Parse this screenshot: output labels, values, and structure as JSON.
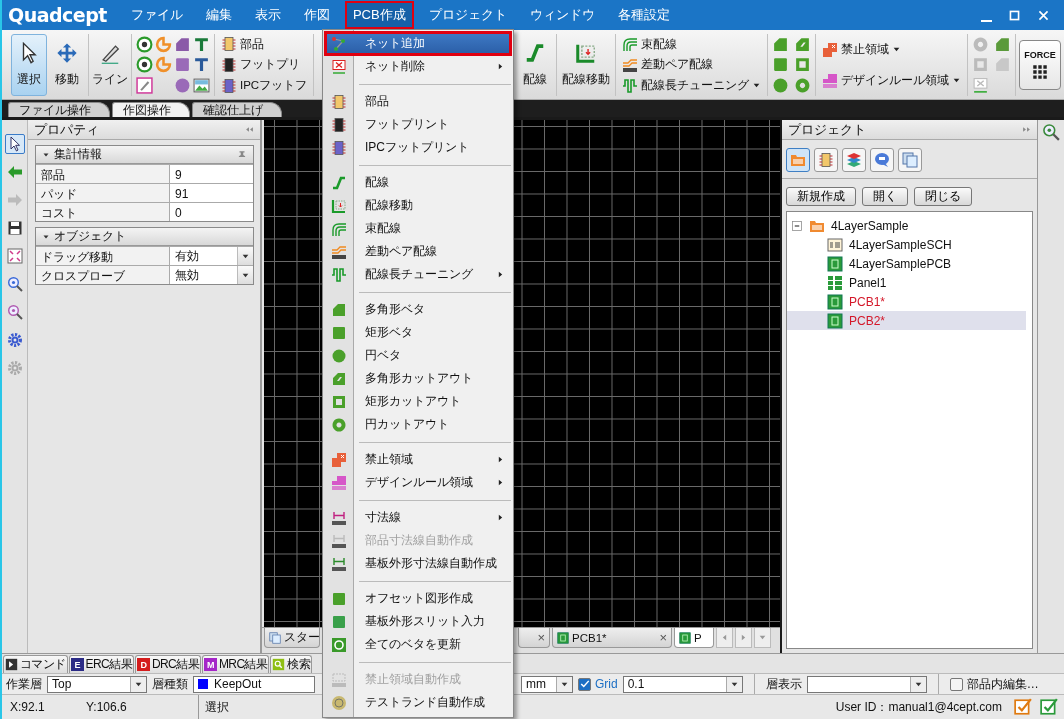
{
  "app": {
    "logo": "Quadcept"
  },
  "menubar": [
    {
      "label": "ファイル",
      "selected": false
    },
    {
      "label": "編集",
      "selected": false
    },
    {
      "label": "表示",
      "selected": false
    },
    {
      "label": "作図",
      "selected": false
    },
    {
      "label": "PCB作成",
      "selected": true
    },
    {
      "label": "プロジェクト",
      "selected": false
    },
    {
      "label": "ウィンドウ",
      "selected": false
    },
    {
      "label": "各種設定",
      "selected": false
    }
  ],
  "ribbon": {
    "groups": [
      {
        "kind": "large",
        "buttons": [
          {
            "label": "選択",
            "selected": true
          },
          {
            "label": "移動",
            "selected": false
          }
        ]
      },
      {
        "kind": "large",
        "buttons": [
          {
            "label": "ライン",
            "selected": false
          }
        ]
      },
      {
        "kind": "icons"
      },
      {
        "kind": "small",
        "items": [
          {
            "label": "部品",
            "dropdown": false
          },
          {
            "label": "フットプリ",
            "dropdown": false
          },
          {
            "label": "IPCフットフ",
            "dropdown": false
          }
        ]
      },
      {
        "kind": "large",
        "buttons": [
          {
            "label": "配線",
            "selected": false
          }
        ]
      },
      {
        "kind": "large",
        "buttons": [
          {
            "label": "配線移動",
            "selected": false
          }
        ]
      },
      {
        "kind": "small",
        "items": [
          {
            "label": "束配線",
            "dropdown": false
          },
          {
            "label": "差動ペア配線",
            "dropdown": false
          },
          {
            "label": "配線長チューニング",
            "dropdown": true
          }
        ]
      },
      {
        "kind": "icons"
      },
      {
        "kind": "small",
        "items": [
          {
            "label": "禁止領域",
            "dropdown": true
          },
          {
            "label": "デザインルール領域",
            "dropdown": true
          }
        ]
      },
      {
        "kind": "icons"
      },
      {
        "kind": "force",
        "label": "FORCE"
      }
    ]
  },
  "ribbon_tabs": [
    {
      "label": "ファイル操作",
      "selected": false
    },
    {
      "label": "作図操作",
      "selected": true
    },
    {
      "label": "確認仕上げ",
      "selected": false
    }
  ],
  "properties": {
    "title": "プロパティ",
    "sections": [
      {
        "title": "集計情報",
        "expanded": true,
        "rows": [
          {
            "name": "部品",
            "value": "9"
          },
          {
            "name": "パッド",
            "value": "91"
          },
          {
            "name": "コスト",
            "value": "0"
          }
        ]
      },
      {
        "title": "オブジェクト",
        "expanded": true,
        "rows": [
          {
            "name": "ドラッグ移動",
            "value": "有効",
            "dropdown": true
          },
          {
            "name": "クロスプローブ",
            "value": "無効",
            "dropdown": true
          }
        ]
      }
    ]
  },
  "doc_tabs": [
    {
      "label": "スター",
      "selected": false
    },
    {
      "close": "×",
      "selected": false
    },
    {
      "label": "PCB1*",
      "close": "×",
      "selected": false
    },
    {
      "label": "P",
      "selected": true
    }
  ],
  "project": {
    "title": "プロジェクト",
    "view_buttons": [
      {
        "selected": true
      },
      {
        "selected": false
      },
      {
        "selected": false
      },
      {
        "selected": false
      },
      {
        "selected": false
      }
    ],
    "buttons": [
      "新規作成",
      "開く",
      "閉じる"
    ],
    "tree": [
      {
        "label": "4LayerSample",
        "kind": "project",
        "expanded": true,
        "selected": false,
        "modified": false,
        "children": [
          {
            "label": "4LayerSampleSCH",
            "kind": "sch",
            "selected": false,
            "modified": false
          },
          {
            "label": "4LayerSamplePCB",
            "kind": "pcb",
            "selected": false,
            "modified": false
          },
          {
            "label": "Panel1",
            "kind": "panel",
            "selected": false,
            "modified": false
          },
          {
            "label": "PCB1*",
            "kind": "pcb",
            "selected": false,
            "modified": true
          },
          {
            "label": "PCB2*",
            "kind": "pcb",
            "selected": true,
            "modified": true
          }
        ]
      }
    ]
  },
  "bottom_tabs": [
    {
      "label": "コマンド",
      "color": "#333333"
    },
    {
      "label": "ERC結果",
      "badge": "E",
      "color": "#2b2b86"
    },
    {
      "label": "DRC結果",
      "badge": "D",
      "color": "#d41c1c"
    },
    {
      "label": "MRC結果",
      "badge": "M",
      "color": "#a526c8"
    },
    {
      "label": "検索",
      "color": "#8fbf14"
    }
  ],
  "options_bar": {
    "work_layer_label": "作業層",
    "work_layer": "Top",
    "layer_type_label": "層種類",
    "layer_type": "KeepOut",
    "unit": "mm",
    "grid": {
      "label": "Grid",
      "checked": true
    },
    "grid_value": "0.1",
    "layer_display_label": "層表示",
    "part_edit": {
      "label": "部品内編集…",
      "checked": false
    }
  },
  "status_bar": {
    "x": "X:92.1",
    "y": "Y:106.6",
    "mode": "選択",
    "user": "User ID：manual1@4cept.com"
  },
  "pcb_menu": {
    "items": [
      {
        "kind": "item",
        "label": "ネット追加",
        "selected": true,
        "disabled": false,
        "submenu": false
      },
      {
        "kind": "item",
        "label": "ネット削除",
        "selected": false,
        "disabled": false,
        "submenu": true
      },
      {
        "kind": "separator"
      },
      {
        "kind": "item",
        "label": "部品",
        "selected": false,
        "disabled": false,
        "submenu": false
      },
      {
        "kind": "item",
        "label": "フットプリント",
        "selected": false,
        "disabled": false,
        "submenu": false
      },
      {
        "kind": "item",
        "label": "IPCフットプリント",
        "selected": false,
        "disabled": false,
        "submenu": false
      },
      {
        "kind": "separator"
      },
      {
        "kind": "item",
        "label": "配線",
        "selected": false,
        "disabled": false,
        "submenu": false
      },
      {
        "kind": "item",
        "label": "配線移動",
        "selected": false,
        "disabled": false,
        "submenu": false
      },
      {
        "kind": "item",
        "label": "束配線",
        "selected": false,
        "disabled": false,
        "submenu": false
      },
      {
        "kind": "item",
        "label": "差動ペア配線",
        "selected": false,
        "disabled": false,
        "submenu": false
      },
      {
        "kind": "item",
        "label": "配線長チューニング",
        "selected": false,
        "disabled": false,
        "submenu": true
      },
      {
        "kind": "separator"
      },
      {
        "kind": "item",
        "label": "多角形ベタ",
        "selected": false,
        "disabled": false,
        "submenu": false
      },
      {
        "kind": "item",
        "label": "矩形ベタ",
        "selected": false,
        "disabled": false,
        "submenu": false
      },
      {
        "kind": "item",
        "label": "円ベタ",
        "selected": false,
        "disabled": false,
        "submenu": false
      },
      {
        "kind": "item",
        "label": "多角形カットアウト",
        "selected": false,
        "disabled": false,
        "submenu": false
      },
      {
        "kind": "item",
        "label": "矩形カットアウト",
        "selected": false,
        "disabled": false,
        "submenu": false
      },
      {
        "kind": "item",
        "label": "円カットアウト",
        "selected": false,
        "disabled": false,
        "submenu": false
      },
      {
        "kind": "separator"
      },
      {
        "kind": "item",
        "label": "禁止領域",
        "selected": false,
        "disabled": false,
        "submenu": true
      },
      {
        "kind": "item",
        "label": "デザインルール領域",
        "selected": false,
        "disabled": false,
        "submenu": true
      },
      {
        "kind": "separator"
      },
      {
        "kind": "item",
        "label": "寸法線",
        "selected": false,
        "disabled": false,
        "submenu": true
      },
      {
        "kind": "item",
        "label": "部品寸法線自動作成",
        "selected": false,
        "disabled": true,
        "submenu": false
      },
      {
        "kind": "item",
        "label": "基板外形寸法線自動作成",
        "selected": false,
        "disabled": false,
        "submenu": false
      },
      {
        "kind": "separator"
      },
      {
        "kind": "item",
        "label": "オフセット図形作成",
        "selected": false,
        "disabled": false,
        "submenu": false
      },
      {
        "kind": "item",
        "label": "基板外形スリット入力",
        "selected": false,
        "disabled": false,
        "submenu": false
      },
      {
        "kind": "item",
        "label": "全てのベタを更新",
        "selected": false,
        "disabled": false,
        "submenu": false
      },
      {
        "kind": "separator"
      },
      {
        "kind": "item",
        "label": "禁止領域自動作成",
        "selected": false,
        "disabled": true,
        "submenu": false
      },
      {
        "kind": "item",
        "label": "テストランド自動作成",
        "selected": false,
        "disabled": false,
        "submenu": false
      }
    ]
  }
}
